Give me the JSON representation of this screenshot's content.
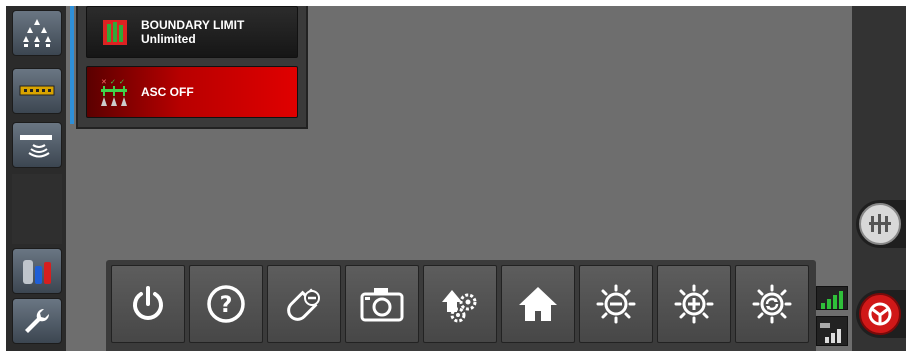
{
  "status_panel": {
    "boundary": {
      "title": "BOUNDARY LIMIT",
      "value": "Unlimited",
      "icon": "boundary-icon"
    },
    "asc": {
      "label": "ASC OFF",
      "icon": "asc-sprayer-icon",
      "color": "#d40000"
    }
  },
  "sidebar_icons": [
    "sprayer-nozzles-icon",
    "boom-sections-icon",
    "implement-sensor-icon",
    "tank-levels-icon",
    "wrench-icon"
  ],
  "right_icons": [
    "steering-config-icon",
    "autosteer-engage-icon"
  ],
  "toolbar_icons": [
    "power-icon",
    "help-icon",
    "usb-icon",
    "camera-icon",
    "setup-icon",
    "home-icon",
    "brightness-down-icon",
    "brightness-up-icon",
    "brightness-auto-icon"
  ],
  "colors": {
    "accent_blue": "#2e8fd8",
    "alert_red": "#d40000",
    "signal_green": "#2fbf3a"
  }
}
